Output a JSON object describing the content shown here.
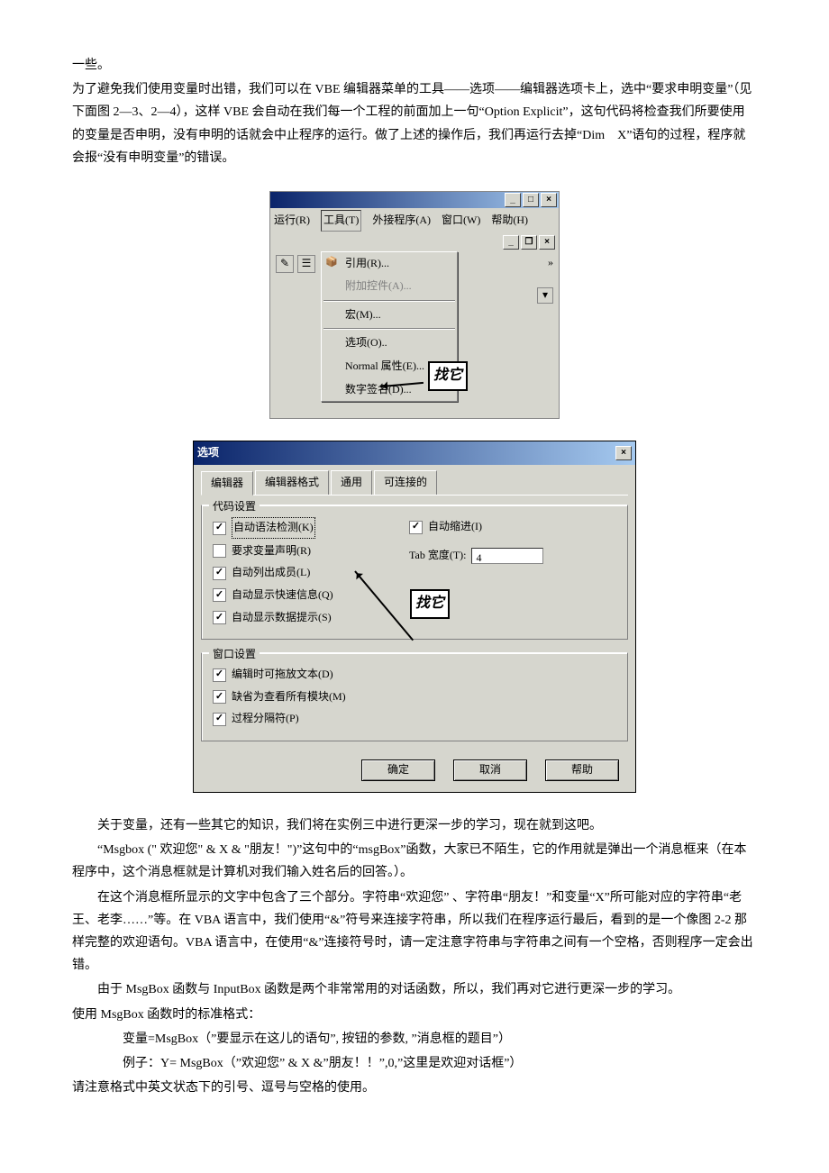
{
  "body": {
    "p1": "一些。",
    "p2": "为了避免我们使用变量时出错，我们可以在 VBE 编辑器菜单的工具——选项——编辑器选项卡上，选中“要求申明变量”（见下面图 2—3、2—4），这样 VBE 会自动在我们每一个工程的前面加上一句“Option Explicit”，这句代码将检查我们所要使用的变量是否申明，没有申明的话就会中止程序的运行。做了上述的操作后，我们再运行去掉“Dim　X”语句的过程，程序就会报“没有申明变量”的错误。",
    "p3": "关于变量，还有一些其它的知识，我们将在实例三中进行更深一步的学习，现在就到这吧。",
    "p4": "“Msgbox (\" 欢迎您\" & X & \"朋友！\")”这句中的“msgBox”函数，大家已不陌生，它的作用就是弹出一个消息框来（在本程序中，这个消息框就是计算机对我们输入姓名后的回答。）。",
    "p5": "在这个消息框所显示的文字中包含了三个部分。字符串“欢迎您” 、字符串“朋友！”和变量“X”所可能对应的字符串“老王、老李……”等。在 VBA 语言中，我们使用“&”符号来连接字符串，所以我们在程序运行最后，看到的是一个像图 2-2 那样完整的欢迎语句。VBA 语言中，在使用“&”连接符号时，请一定注意字符串与字符串之间有一个空格，否则程序一定会出错。",
    "p6": "由于 MsgBox 函数与 InputBox 函数是两个非常常用的对话函数，所以，我们再对它进行更深一步的学习。",
    "p7": "使用 MsgBox 函数时的标准格式：",
    "p8": "变量=MsgBox（”要显示在这儿的语句”, 按钮的参数, ”消息框的题目”）",
    "p9": "例子：Y= MsgBox（”欢迎您” & X &”朋友！！”,0,”这里是欢迎对话框”）",
    "p10": "请注意格式中英文状态下的引号、逗号与空格的使用。"
  },
  "fig1": {
    "menus": {
      "run": "运行(R)",
      "tools": "工具(T)",
      "addin": "外接程序(A)",
      "window": "窗口(W)",
      "help": "帮助(H)"
    },
    "dd": {
      "ref": "引用(R)...",
      "ctrl": "附加控件(A)...",
      "macro": "宏(M)...",
      "options": "选项(O)..",
      "normal": "Normal 属性(E)...",
      "sign": "数字签名(D)..."
    },
    "callout": "找它"
  },
  "fig2": {
    "title": "选项",
    "tabs": {
      "t1": "编辑器",
      "t2": "编辑器格式",
      "t3": "通用",
      "t4": "可连接的"
    },
    "g1": {
      "title": "代码设置",
      "c1": "自动语法检测(K)",
      "c2": "要求变量声明(R)",
      "c3": "自动列出成员(L)",
      "c4": "自动显示快速信息(Q)",
      "c5": "自动显示数据提示(S)",
      "r1": "自动缩进(I)",
      "r2lbl": "Tab 宽度(T):",
      "r2val": "4"
    },
    "g2": {
      "title": "窗口设置",
      "c1": "编辑时可拖放文本(D)",
      "c2": "缺省为查看所有模块(M)",
      "c3": "过程分隔符(P)"
    },
    "btns": {
      "ok": "确定",
      "cancel": "取消",
      "help": "帮助"
    },
    "callout": "找它"
  }
}
